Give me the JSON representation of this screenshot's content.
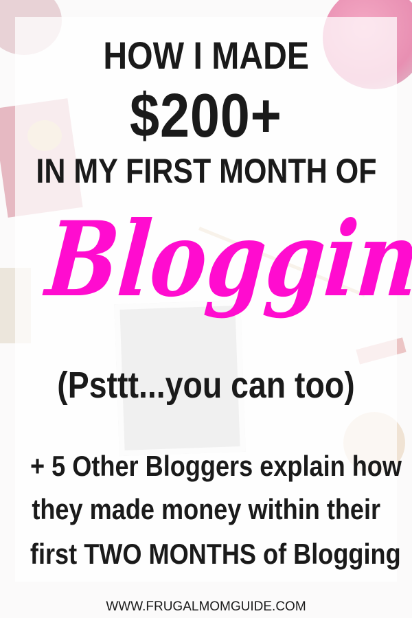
{
  "headline": {
    "line1": "HOW I MADE",
    "amount": "$200+",
    "line3": "IN MY FIRST MONTH OF",
    "script_word": "Blogging",
    "aside": "(Psttt...you can too)"
  },
  "subtext": {
    "line1": "+ 5 Other Bloggers explain how",
    "line2": "they made money within their",
    "line3": "first TWO MONTHS of Blogging"
  },
  "footer": {
    "url": "WWW.FRUGALMOMGUIDE.COM"
  },
  "colors": {
    "accent": "#ff0ccf",
    "text": "#1a1a1a",
    "tablet": "#c9c9c9"
  }
}
